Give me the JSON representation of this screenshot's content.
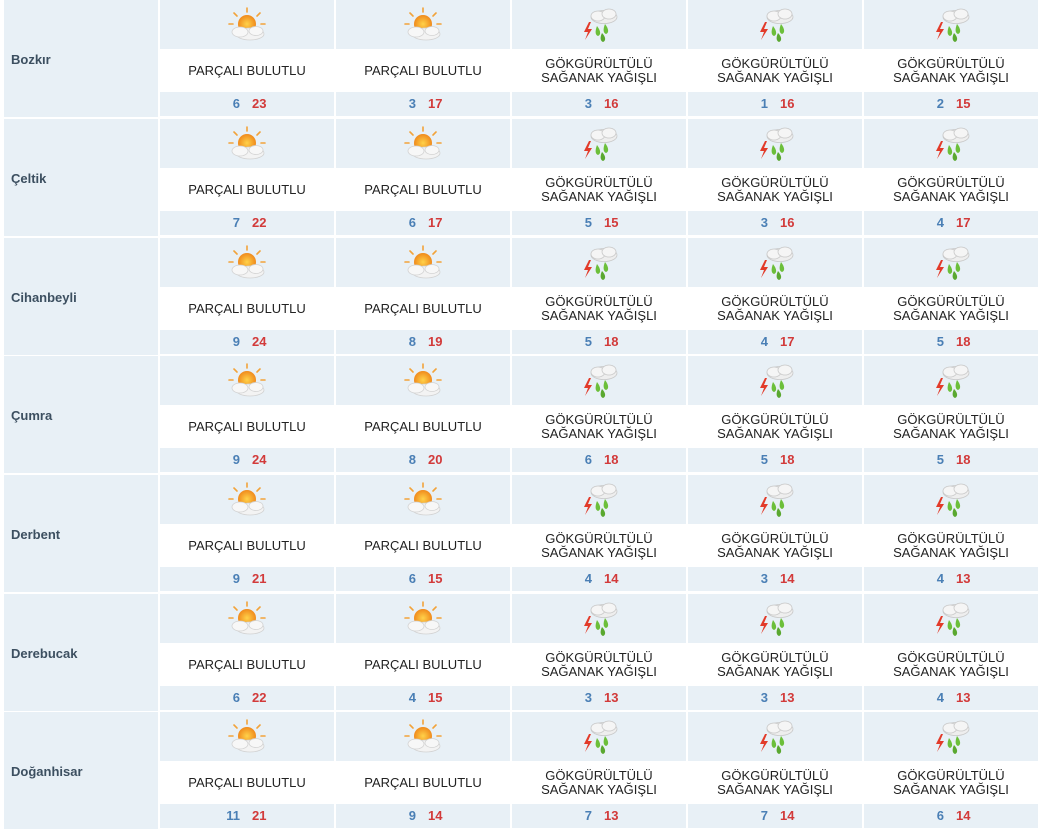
{
  "days_count": 5,
  "weather_types": {
    "partly": "PARÇALI BULUTLU",
    "storm": "GÖKGÜRÜLTÜLÜ\nSAĞANAK YAĞIŞLI"
  },
  "rows": [
    {
      "city": "Bozkır",
      "days": [
        {
          "type": "partly",
          "icon": "partly-cloudy-icon",
          "desc": "PARÇALI BULUTLU",
          "min": "6",
          "max": "23"
        },
        {
          "type": "partly",
          "icon": "partly-cloudy-icon",
          "desc": "PARÇALI BULUTLU",
          "min": "3",
          "max": "17"
        },
        {
          "type": "storm",
          "icon": "thunderstorm-icon",
          "desc": "GÖKGÜRÜLTÜLÜ\nSAĞANAK YAĞIŞLI",
          "min": "3",
          "max": "16"
        },
        {
          "type": "storm",
          "icon": "thunderstorm-icon",
          "desc": "GÖKGÜRÜLTÜLÜ\nSAĞANAK YAĞIŞLI",
          "min": "1",
          "max": "16"
        },
        {
          "type": "storm",
          "icon": "thunderstorm-icon",
          "desc": "GÖKGÜRÜLTÜLÜ\nSAĞANAK YAĞIŞLI",
          "min": "2",
          "max": "15"
        }
      ]
    },
    {
      "city": "Çeltik",
      "days": [
        {
          "type": "partly",
          "icon": "partly-cloudy-icon",
          "desc": "PARÇALI BULUTLU",
          "min": "7",
          "max": "22"
        },
        {
          "type": "partly",
          "icon": "partly-cloudy-icon",
          "desc": "PARÇALI BULUTLU",
          "min": "6",
          "max": "17"
        },
        {
          "type": "storm",
          "icon": "thunderstorm-icon",
          "desc": "GÖKGÜRÜLTÜLÜ\nSAĞANAK YAĞIŞLI",
          "min": "5",
          "max": "15"
        },
        {
          "type": "storm",
          "icon": "thunderstorm-icon",
          "desc": "GÖKGÜRÜLTÜLÜ\nSAĞANAK YAĞIŞLI",
          "min": "3",
          "max": "16"
        },
        {
          "type": "storm",
          "icon": "thunderstorm-icon",
          "desc": "GÖKGÜRÜLTÜLÜ\nSAĞANAK YAĞIŞLI",
          "min": "4",
          "max": "17"
        }
      ]
    },
    {
      "city": "Cihanbeyli",
      "days": [
        {
          "type": "partly",
          "icon": "partly-cloudy-icon",
          "desc": "PARÇALI BULUTLU",
          "min": "9",
          "max": "24"
        },
        {
          "type": "partly",
          "icon": "partly-cloudy-icon",
          "desc": "PARÇALI BULUTLU",
          "min": "8",
          "max": "19"
        },
        {
          "type": "storm",
          "icon": "thunderstorm-icon",
          "desc": "GÖKGÜRÜLTÜLÜ\nSAĞANAK YAĞIŞLI",
          "min": "5",
          "max": "18"
        },
        {
          "type": "storm",
          "icon": "thunderstorm-icon",
          "desc": "GÖKGÜRÜLTÜLÜ\nSAĞANAK YAĞIŞLI",
          "min": "4",
          "max": "17"
        },
        {
          "type": "storm",
          "icon": "thunderstorm-icon",
          "desc": "GÖKGÜRÜLTÜLÜ\nSAĞANAK YAĞIŞLI",
          "min": "5",
          "max": "18"
        }
      ]
    },
    {
      "city": "Çumra",
      "days": [
        {
          "type": "partly",
          "icon": "partly-cloudy-icon",
          "desc": "PARÇALI BULUTLU",
          "min": "9",
          "max": "24"
        },
        {
          "type": "partly",
          "icon": "partly-cloudy-icon",
          "desc": "PARÇALI BULUTLU",
          "min": "8",
          "max": "20"
        },
        {
          "type": "storm",
          "icon": "thunderstorm-icon",
          "desc": "GÖKGÜRÜLTÜLÜ\nSAĞANAK YAĞIŞLI",
          "min": "6",
          "max": "18"
        },
        {
          "type": "storm",
          "icon": "thunderstorm-icon",
          "desc": "GÖKGÜRÜLTÜLÜ\nSAĞANAK YAĞIŞLI",
          "min": "5",
          "max": "18"
        },
        {
          "type": "storm",
          "icon": "thunderstorm-icon",
          "desc": "GÖKGÜRÜLTÜLÜ\nSAĞANAK YAĞIŞLI",
          "min": "5",
          "max": "18"
        }
      ]
    },
    {
      "city": "Derbent",
      "days": [
        {
          "type": "partly",
          "icon": "partly-cloudy-icon",
          "desc": "PARÇALI BULUTLU",
          "min": "9",
          "max": "21"
        },
        {
          "type": "partly",
          "icon": "partly-cloudy-icon",
          "desc": "PARÇALI BULUTLU",
          "min": "6",
          "max": "15"
        },
        {
          "type": "storm",
          "icon": "thunderstorm-icon",
          "desc": "GÖKGÜRÜLTÜLÜ\nSAĞANAK YAĞIŞLI",
          "min": "4",
          "max": "14"
        },
        {
          "type": "storm",
          "icon": "thunderstorm-icon",
          "desc": "GÖKGÜRÜLTÜLÜ\nSAĞANAK YAĞIŞLI",
          "min": "3",
          "max": "14"
        },
        {
          "type": "storm",
          "icon": "thunderstorm-icon",
          "desc": "GÖKGÜRÜLTÜLÜ\nSAĞANAK YAĞIŞLI",
          "min": "4",
          "max": "13"
        }
      ]
    },
    {
      "city": "Derebucak",
      "days": [
        {
          "type": "partly",
          "icon": "partly-cloudy-icon",
          "desc": "PARÇALI BULUTLU",
          "min": "6",
          "max": "22"
        },
        {
          "type": "partly",
          "icon": "partly-cloudy-icon",
          "desc": "PARÇALI BULUTLU",
          "min": "4",
          "max": "15"
        },
        {
          "type": "storm",
          "icon": "thunderstorm-icon",
          "desc": "GÖKGÜRÜLTÜLÜ\nSAĞANAK YAĞIŞLI",
          "min": "3",
          "max": "13"
        },
        {
          "type": "storm",
          "icon": "thunderstorm-icon",
          "desc": "GÖKGÜRÜLTÜLÜ\nSAĞANAK YAĞIŞLI",
          "min": "3",
          "max": "13"
        },
        {
          "type": "storm",
          "icon": "thunderstorm-icon",
          "desc": "GÖKGÜRÜLTÜLÜ\nSAĞANAK YAĞIŞLI",
          "min": "4",
          "max": "13"
        }
      ]
    },
    {
      "city": "Doğanhisar",
      "days": [
        {
          "type": "partly",
          "icon": "partly-cloudy-icon",
          "desc": "PARÇALI BULUTLU",
          "min": "11",
          "max": "21"
        },
        {
          "type": "partly",
          "icon": "partly-cloudy-icon",
          "desc": "PARÇALI BULUTLU",
          "min": "9",
          "max": "14"
        },
        {
          "type": "storm",
          "icon": "thunderstorm-icon",
          "desc": "GÖKGÜRÜLTÜLÜ\nSAĞANAK YAĞIŞLI",
          "min": "7",
          "max": "13"
        },
        {
          "type": "storm",
          "icon": "thunderstorm-icon",
          "desc": "GÖKGÜRÜLTÜLÜ\nSAĞANAK YAĞIŞLI",
          "min": "7",
          "max": "14"
        },
        {
          "type": "storm",
          "icon": "thunderstorm-icon",
          "desc": "GÖKGÜRÜLTÜLÜ\nSAĞANAK YAĞIŞLI",
          "min": "6",
          "max": "14"
        }
      ]
    }
  ]
}
